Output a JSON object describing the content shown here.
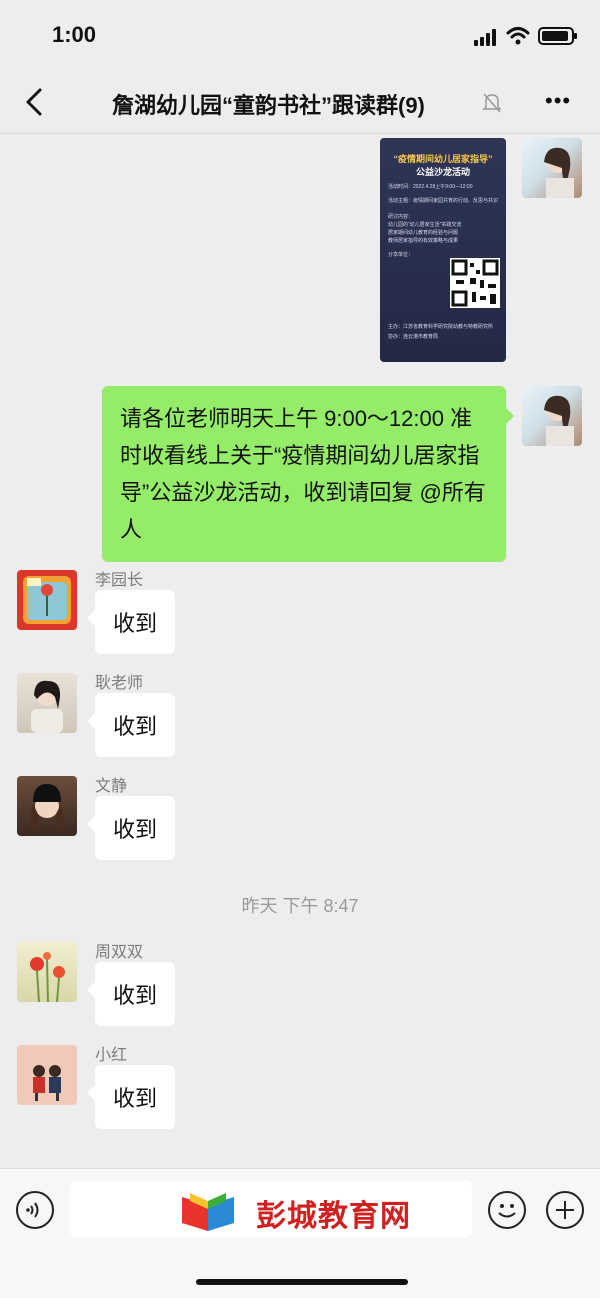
{
  "status": {
    "time": "1:00"
  },
  "header": {
    "title": "詹湖幼儿园“童韵书社”跟读群(9)",
    "more_label": "•••"
  },
  "poster": {
    "title_line1": "“疫情期间幼儿居家指导”",
    "title_line2": "公益沙龙活动",
    "time_text": "活动时间：2022.4.28上午9:00—12:00",
    "theme_text": "活动主题：疫情期间家园共育的行动、反思与共识",
    "content_label": "研讨内容：",
    "items": [
      "幼儿园的“幼儿居家生活”实践交流",
      "居家期间幼儿教育的经验与问题",
      "教师居家指导的有效策略与成果"
    ],
    "share_label": "分享单位：",
    "organizer_text": "主办：江苏省教育科学研究院幼教与特教研究所",
    "co_text": "协办：连云港市教育局"
  },
  "messages": {
    "out_text": "请各位老师明天上午 9:00～12:00 准时收看线上关于“疫情期间幼儿居家指导”公益沙龙活动，收到请回复 @所有人",
    "m1": {
      "name": "李园长",
      "text": "收到"
    },
    "m2": {
      "name": "耿老师",
      "text": "收到"
    },
    "m3": {
      "name": "文静",
      "text": "收到"
    },
    "m4": {
      "name": "周双双",
      "text": "收到"
    },
    "m5": {
      "name": "小红",
      "text": "收到"
    }
  },
  "timestamp": "昨天 下午 8:47",
  "watermark": {
    "text": "彭城教育网"
  },
  "colors": {
    "sent_bubble": "#95ec69",
    "background": "#ededed",
    "watermark_red": "#d0201f"
  }
}
